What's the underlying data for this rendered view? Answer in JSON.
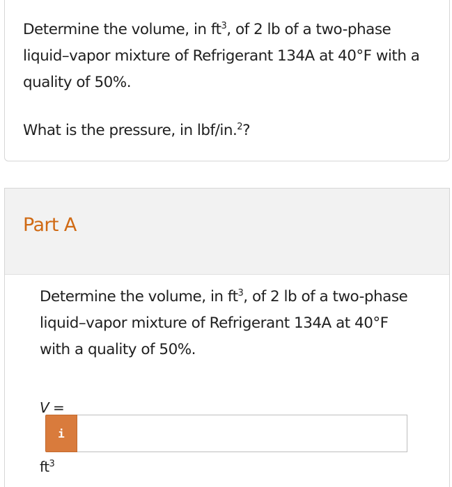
{
  "problem": {
    "intro_prefix": "Determine the volume, in ft",
    "intro_sup": "3",
    "intro_suffix": ", of 2 lb of a two-phase liquid–vapor mixture of Refrigerant 134A at 40°F with a quality of 50%.",
    "question_prefix": "What is the pressure, in lbf/in.",
    "question_sup": "2",
    "question_suffix": "?"
  },
  "part_a": {
    "title": "Part A",
    "text_prefix": "Determine the volume, in ft",
    "text_sup": "3",
    "text_suffix": ", of 2 lb of a two-phase liquid–vapor mixture of Refrigerant 134A at 40°F with a quality of 50%.",
    "variable": "V",
    "equals": " =",
    "info_icon_label": "i",
    "answer_value": "",
    "unit_base": "ft",
    "unit_sup": "3"
  },
  "colors": {
    "accent": "#d06a14",
    "info_button": "#d97b3c"
  }
}
